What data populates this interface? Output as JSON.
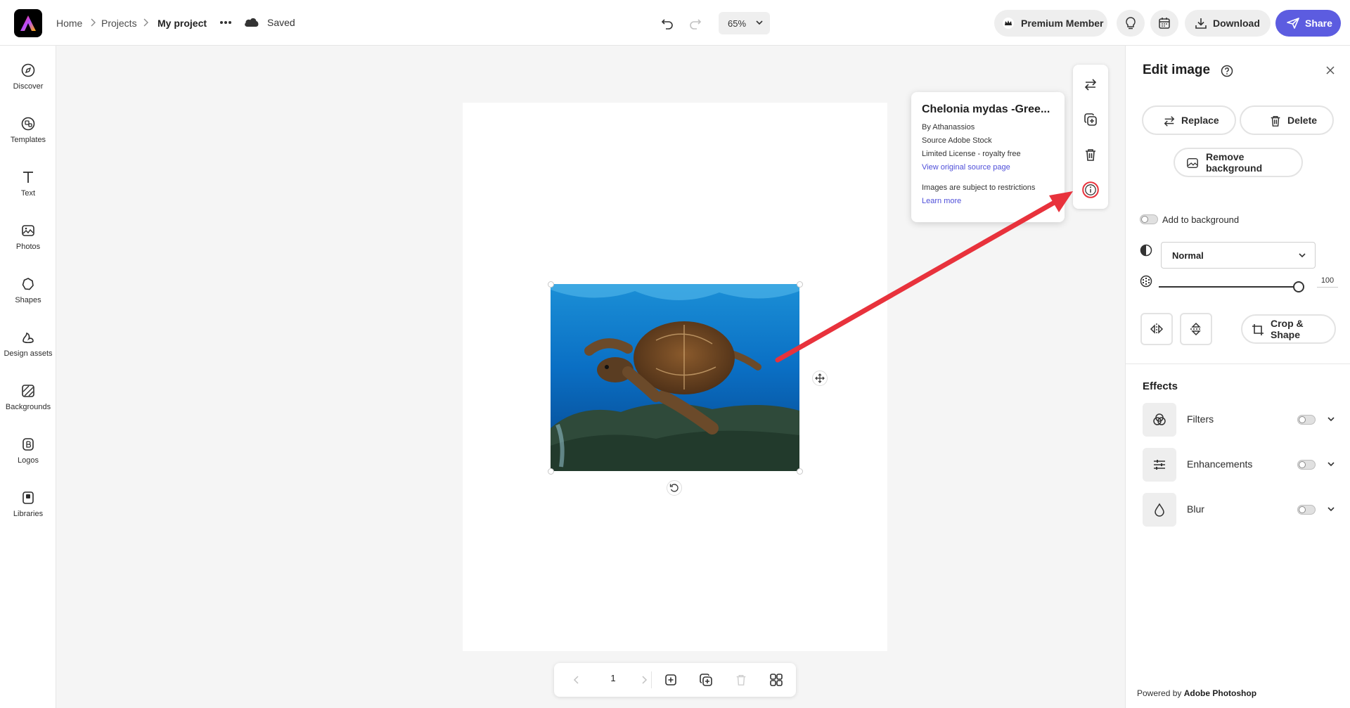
{
  "header": {
    "breadcrumb": [
      "Home",
      "Projects",
      "My project"
    ],
    "save_status": "Saved",
    "zoom": "65%",
    "premium_label": "Premium Member",
    "download_label": "Download",
    "share_label": "Share"
  },
  "sidebar": {
    "items": [
      {
        "label": "Discover",
        "icon": "compass-icon"
      },
      {
        "label": "Templates",
        "icon": "templates-icon"
      },
      {
        "label": "Text",
        "icon": "text-icon"
      },
      {
        "label": "Photos",
        "icon": "photo-icon"
      },
      {
        "label": "Shapes",
        "icon": "shapes-icon"
      },
      {
        "label": "Design assets",
        "icon": "design-assets-icon"
      },
      {
        "label": "Backgrounds",
        "icon": "backgrounds-icon"
      },
      {
        "label": "Logos",
        "icon": "logos-icon"
      },
      {
        "label": "Libraries",
        "icon": "libraries-icon"
      }
    ]
  },
  "image_info": {
    "title": "Chelonia mydas -Gree...",
    "author": "By Athanassios",
    "source": "Source Adobe Stock",
    "license": "Limited License - royalty free",
    "source_link": "View original source page",
    "restriction": "Images are subject to restrictions",
    "learn_more": "Learn more"
  },
  "page_nav": {
    "current_page": "1"
  },
  "edit_panel": {
    "title": "Edit image",
    "replace_label": "Replace",
    "delete_label": "Delete",
    "remove_bg_label": "Remove background",
    "add_to_background_label": "Add to background",
    "blend_mode": "Normal",
    "opacity_value": "100",
    "opacity_fraction": 1.0,
    "crop_label": "Crop & Shape",
    "effects_title": "Effects",
    "effects": [
      {
        "label": "Filters",
        "icon": "filters-icon",
        "enabled": false
      },
      {
        "label": "Enhancements",
        "icon": "sliders-icon",
        "enabled": false
      },
      {
        "label": "Blur",
        "icon": "blur-drop-icon",
        "enabled": false
      }
    ],
    "powered_prefix": "Powered by",
    "powered_brand": "Adobe Photoshop"
  },
  "colors": {
    "accent": "#5c5ce0",
    "annotation_arrow": "#e8323c",
    "link": "#4f4fd9"
  }
}
